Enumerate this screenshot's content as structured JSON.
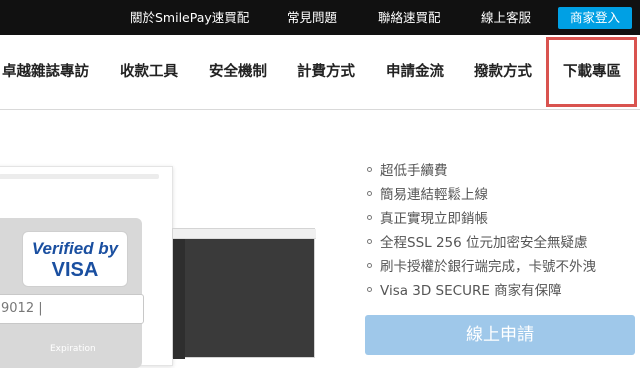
{
  "topbar": {
    "links": [
      "關於SmilePay速買配",
      "常見問題",
      "聯絡速買配",
      "線上客服"
    ],
    "login_label": "商家登入",
    "login_color": "#00a0e4"
  },
  "nav": {
    "items": [
      "卓越雜誌專訪",
      "收款工具",
      "安全機制",
      "計費方式",
      "申請金流",
      "撥款方式",
      "下載專區"
    ],
    "highlight_color": "#d9534f"
  },
  "hero": {
    "visa_line1": "Verified by",
    "visa_line2": "VISA",
    "card_number": "9012",
    "expiry_label": "Expiration",
    "features": [
      "超低手續費",
      "簡易連結輕鬆上線",
      "真正實現立即銷帳",
      "全程SSL 256 位元加密安全無疑慮",
      "刷卡授權於銀行端完成，卡號不外洩",
      "Visa 3D SECURE 商家有保障"
    ],
    "apply_label": "線上申請"
  }
}
